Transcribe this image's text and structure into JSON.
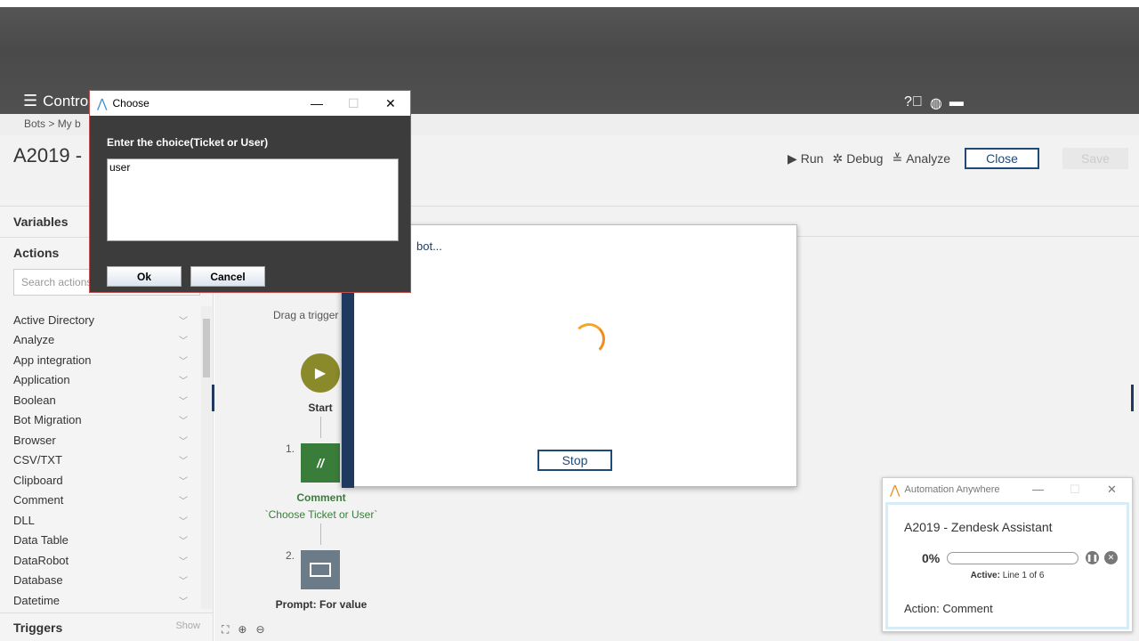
{
  "header": {
    "menu_label": "Control Room",
    "icons": [
      "help-icon",
      "globe-icon",
      "monitor-icon"
    ]
  },
  "breadcrumb": "Bots  >  My b",
  "bot": {
    "title": "A2019 -",
    "run_label": "Run",
    "debug_label": "Debug",
    "analyze_label": "Analyze",
    "close_label": "Close",
    "save_label": "Save"
  },
  "sidebar": {
    "variables_label": "Variables",
    "actions_label": "Actions",
    "search_placeholder": "Search actions",
    "items": [
      "Active Directory",
      "Analyze",
      "App integration",
      "Application",
      "Boolean",
      "Bot Migration",
      "Browser",
      "CSV/TXT",
      "Clipboard",
      "Comment",
      "DLL",
      "Data Table",
      "DataRobot",
      "Database",
      "Datetime"
    ],
    "triggers_label": "Triggers",
    "show_label": "Show"
  },
  "canvas": {
    "drag_text": "Drag a trigger",
    "start_label": "Start",
    "step1_num": "1.",
    "step1_title": "Comment",
    "step1_subtitle": "`Choose Ticket or User`",
    "step2_num": "2.",
    "step2_title": "Prompt: For value"
  },
  "run_modal": {
    "message": "bot...",
    "stop_label": "Stop"
  },
  "choose_dialog": {
    "title": "Choose",
    "prompt": "Enter the choice(Ticket or User)",
    "value": "user",
    "ok_label": "Ok",
    "cancel_label": "Cancel"
  },
  "aa_window": {
    "title": "Automation Anywhere",
    "bot_name": "A2019 -  Zendesk Assistant",
    "progress_text": "0%",
    "progress": 0,
    "active_label": "Active:",
    "active_value": " Line 1 of 6",
    "action_text": "Action: Comment"
  },
  "colors": {
    "header_bg": "#4f4f4f",
    "accent_navy": "#1e3a5f",
    "comment_green": "#3a7d3a",
    "start_olive": "#8a8a2a",
    "spinner_orange": "#f28c1e",
    "dialog_border": "#c0504d"
  }
}
